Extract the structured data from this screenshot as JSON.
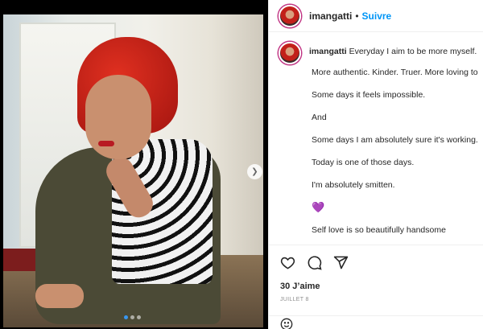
{
  "header": {
    "username": "imangatti",
    "separator": "•",
    "follow_label": "Suivre"
  },
  "caption": {
    "username": "imangatti",
    "lines": [
      "Everyday I aim to be more myself.",
      "More authentic. Kinder. Truer. More loving to",
      "Some days it feels impossible.",
      "And",
      "Some days I am absolutely sure it's working.",
      "Today is one of those days.",
      "I'm absolutely smitten.",
      "💜",
      "Self love is so beautifully handsome"
    ]
  },
  "actions": {
    "likes": "30 J’aime",
    "date": "JUILLET 8"
  },
  "comment": {
    "placeholder": ""
  },
  "carousel": {
    "current": 1,
    "total": 3
  },
  "icons": {
    "like": "heart-outline-icon",
    "comment": "comment-bubble-icon",
    "share": "paper-plane-icon",
    "next": "chevron-right-icon",
    "emoji": "emoji-smile-icon"
  },
  "colors": {
    "link": "#0095f6",
    "text": "#262626",
    "muted": "#8e8e8e",
    "accent_heart": "#8b3fd9"
  }
}
